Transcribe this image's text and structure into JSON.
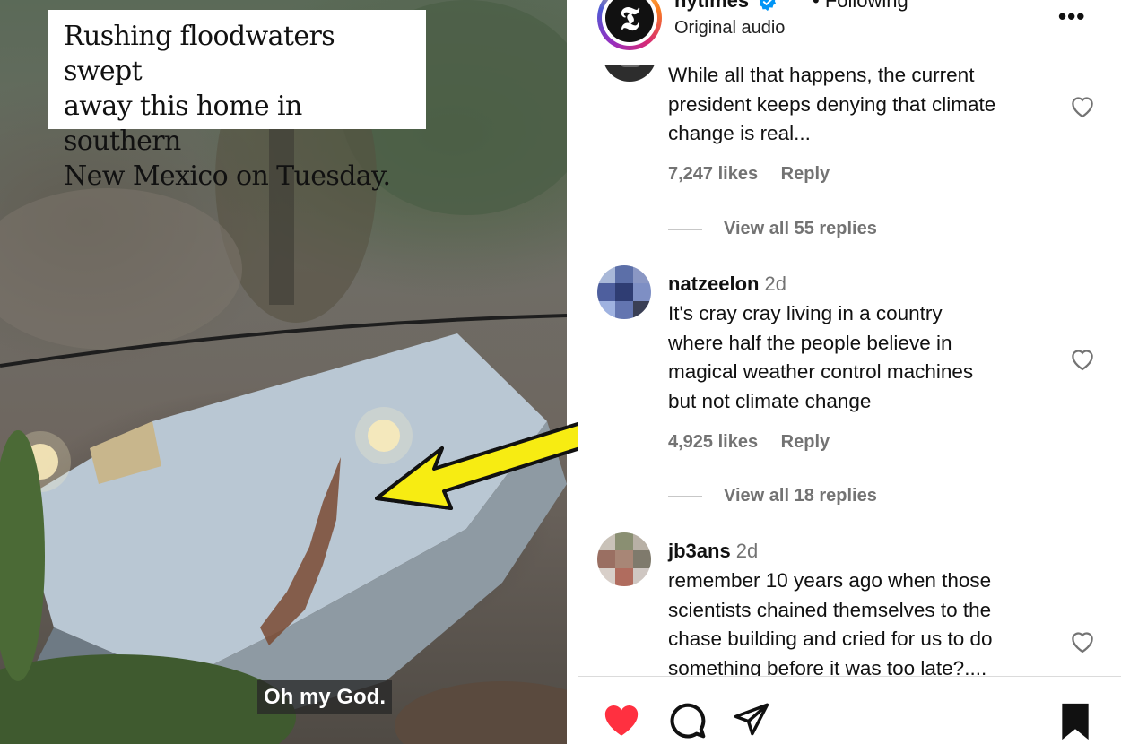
{
  "video": {
    "caption": "Rushing floodwaters swept\naway this home in southern\nNew Mexico on Tuesday.",
    "subtitle": "Oh my God."
  },
  "header": {
    "username": "nytimes",
    "following_label": "• Following",
    "audio_label": "Original audio",
    "logo_glyph": "𝕿",
    "more_glyph": "•••"
  },
  "comments": [
    {
      "username": "",
      "time": "",
      "text": "While all that happens, the current\npresident keeps denying that climate\nchange is real...",
      "likes": "7,247 likes",
      "reply_label": "Reply",
      "view_replies": "View all 55 replies"
    },
    {
      "username": "natzeelon",
      "time": "2d",
      "text": "It's cray cray living in a country\nwhere half the people believe in\nmagical weather control machines\nbut not climate change",
      "likes": "4,925 likes",
      "reply_label": "Reply",
      "view_replies": "View all 18 replies"
    },
    {
      "username": "jb3ans",
      "time": "2d",
      "text": "remember 10 years ago when those\nscientists chained themselves to the\nchase building and cried for us to do\nsomething before it was too late?....",
      "likes": "",
      "reply_label": "",
      "view_replies": ""
    }
  ],
  "colors": {
    "arrow": "#f7ec12",
    "like_active": "#ff3040",
    "verified": "#0095f6",
    "secondary_text": "#737373"
  },
  "icons": {
    "actions": [
      "heart-filled-icon",
      "comment-icon",
      "share-icon",
      "bookmark-icon"
    ],
    "comment_like": "heart-outline-icon"
  }
}
